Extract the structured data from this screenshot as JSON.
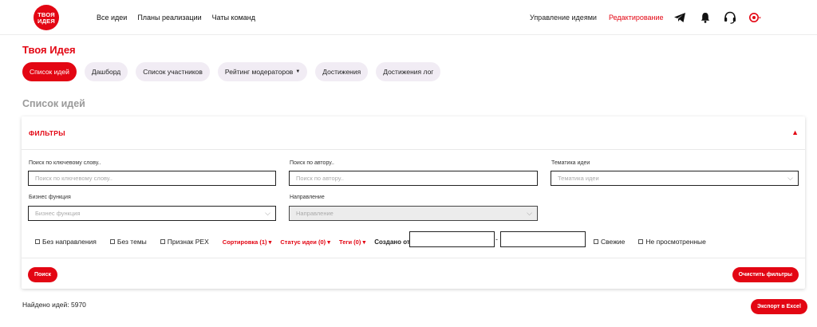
{
  "header": {
    "logo_text_line1": "ТВОЯ",
    "logo_text_line2": "ИДЕЯ",
    "nav": [
      "Все идеи",
      "Планы реализации",
      "Чаты команд"
    ],
    "manage_ideas": "Управление идеями",
    "editing": "Редактирование",
    "icons": [
      "telegram-icon",
      "bell-icon",
      "support-headset-icon",
      "user-settings-icon"
    ]
  },
  "page": {
    "brand_title": "Твоя Идея",
    "section_title": "Список идей",
    "found_text": "Найдено идей: 5970"
  },
  "tabs": [
    {
      "label": "Список идей",
      "active": true
    },
    {
      "label": "Дашборд",
      "active": false
    },
    {
      "label": "Список участников",
      "active": false
    },
    {
      "label": "Рейтинг модераторов",
      "active": false,
      "dropdown": true
    },
    {
      "label": "Достижения",
      "active": false
    },
    {
      "label": "Достижения лог",
      "active": false
    }
  ],
  "filters": {
    "title": "ФИЛЬТРЫ",
    "keyword_label": "Поиск по ключевому слову..",
    "keyword_placeholder": "Поиск по ключевому слову..",
    "author_label": "Поиск по автору..",
    "author_placeholder": "Поиск по автору..",
    "topic_label": "Тематика идеи",
    "topic_placeholder": "Тематика идеи",
    "business_label": "Бизнес функция",
    "business_placeholder": "Бизнес функция",
    "direction_label": "Направление",
    "direction_placeholder": "Направление",
    "checkboxes": {
      "no_direction": "Без направления",
      "no_topic": "Без темы",
      "rex": "Признак РЕХ",
      "fresh": "Свежие",
      "not_viewed": "Не просмотренные"
    },
    "sort": "Сортировка (1)",
    "status": "Статус идеи (0)",
    "tags": "Теги (0)",
    "created_from": "Создано от",
    "dash": "-",
    "search_button": "Поиск",
    "clear_button": "Очистить фильтры"
  },
  "export_button": "Экспорт в Excel",
  "colors": {
    "accent": "#e30613",
    "tab_bg": "#f1ecf4"
  }
}
